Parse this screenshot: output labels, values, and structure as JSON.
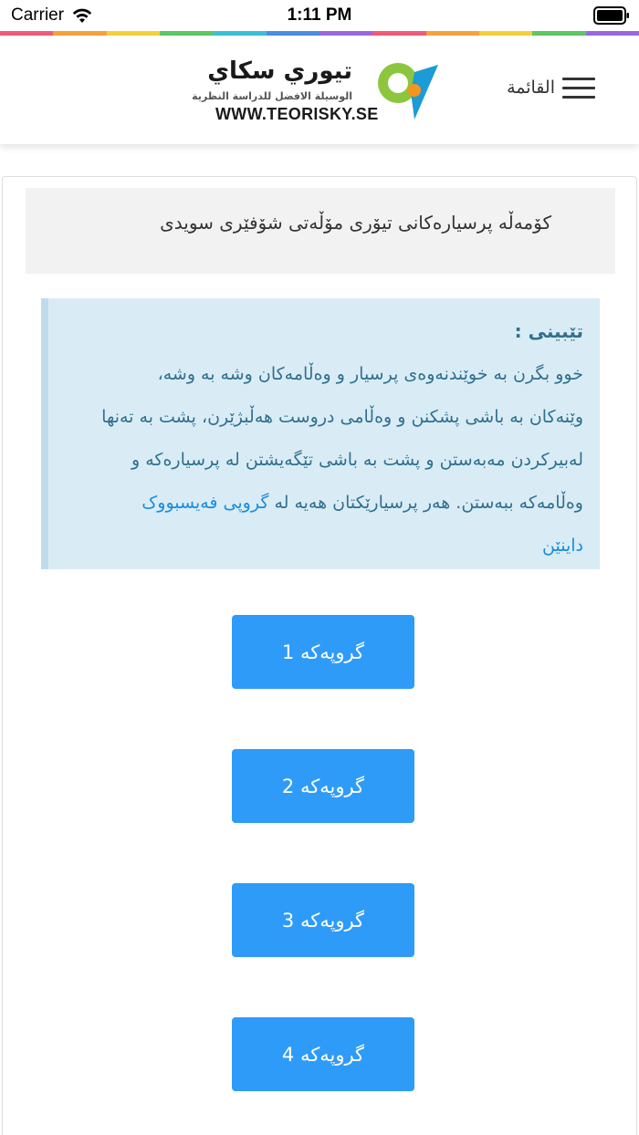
{
  "status_bar": {
    "carrier": "Carrier",
    "time": "1:11 PM"
  },
  "rainbow_colors": [
    "#f25c7a",
    "#f7a43c",
    "#f5d33b",
    "#5fc964",
    "#3bc3d8",
    "#4d8ee8",
    "#9b6ae3",
    "#f25c7a",
    "#f7a43c",
    "#f5d33b",
    "#5fc964",
    "#9b6ae3"
  ],
  "header": {
    "menu_label": "القائمة",
    "logo": {
      "title": "تيوري سكاي",
      "subtitle": "الوسيلة الافضل للدراسة النظرية",
      "url": "WWW.TEORISKY.SE",
      "colors": {
        "green": "#8cc63f",
        "blue": "#1d9bd7",
        "orange": "#f7941d"
      }
    }
  },
  "main": {
    "title": "کۆمەڵە پرسیارەکانی تیۆری مۆڵەتی شۆفێری سویدی",
    "note": {
      "heading": "تێبینی :",
      "body": "خوو بگرن بە خوێندنەوەی پرسیار و وەڵامەکان وشە بە وشە، وێنەکان بە باشی پشکنن و وەڵامی دروست هەڵبژێرن، پشت بە تەنها لەبیرکردن مەبەستن و پشت بە باشی تێگەیشتن لە پرسیارەکە و وەڵامەکە ببەستن. هەر پرسیارێکتان هەیە لە",
      "link_text": "گروپی فەیسبووک داینێن"
    },
    "groups": [
      {
        "label": "گروپەکە 1"
      },
      {
        "label": "گروپەکە 2"
      },
      {
        "label": "گروپەکە 3"
      },
      {
        "label": "گروپەکە 4"
      }
    ],
    "button_color": "#2f9bf9"
  }
}
